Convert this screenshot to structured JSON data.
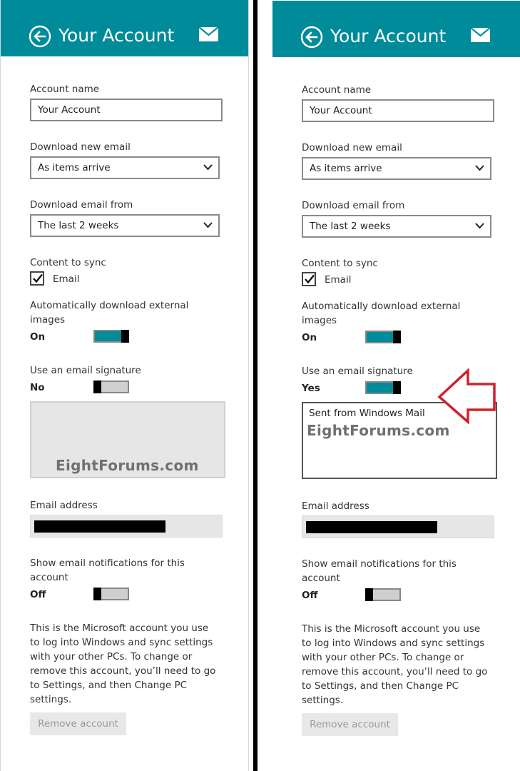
{
  "panels": [
    {
      "header": {
        "title": "Your Account"
      },
      "account_name": {
        "label": "Account name",
        "value": "Your Account"
      },
      "download_new": {
        "label": "Download new email",
        "value": "As items arrive"
      },
      "download_from": {
        "label": "Download email from",
        "value": "The last 2 weeks"
      },
      "content_sync": {
        "label": "Content to sync",
        "option": "Email",
        "checked": true
      },
      "external_images": {
        "label_line1": "Automatically download external",
        "label_line2": "images",
        "state": "On"
      },
      "signature": {
        "label": "Use an email signature",
        "state": "No",
        "text": ""
      },
      "watermark": "EightForums.com",
      "email_address": {
        "label": "Email address"
      },
      "notifications": {
        "label_line1": "Show email notifications for this",
        "label_line2": "account",
        "state": "Off"
      },
      "info_lines": [
        "This is the Microsoft account you use",
        "to log into Windows and sync settings",
        "with your other PCs. To change or",
        "remove this account, you’ll need to go",
        "to Settings, and then Change PC",
        "settings."
      ],
      "remove_label": "Remove account"
    },
    {
      "header": {
        "title": "Your Account"
      },
      "account_name": {
        "label": "Account name",
        "value": "Your Account"
      },
      "download_new": {
        "label": "Download new email",
        "value": "As items arrive"
      },
      "download_from": {
        "label": "Download email from",
        "value": "The last 2 weeks"
      },
      "content_sync": {
        "label": "Content to sync",
        "option": "Email",
        "checked": true
      },
      "external_images": {
        "label_line1": "Automatically download external",
        "label_line2": "images",
        "state": "On"
      },
      "signature": {
        "label": "Use an email signature",
        "state": "Yes",
        "text": "Sent from Windows Mail"
      },
      "watermark": "EightForums.com",
      "email_address": {
        "label": "Email address"
      },
      "notifications": {
        "label_line1": "Show email notifications for this",
        "label_line2": "account",
        "state": "Off"
      },
      "info_lines": [
        "This is the Microsoft account you use",
        "to log into Windows and sync settings",
        "with your other PCs. To change or",
        "remove this account, you’ll need to go",
        "to Settings, and then Change PC",
        "settings."
      ],
      "remove_label": "Remove account"
    }
  ],
  "colors": {
    "accent": "#008b9a",
    "annotation_arrow": "#d0212b"
  },
  "icons": {
    "back": "back-arrow-circle-icon",
    "mail": "mail-envelope-icon",
    "dropdown": "chevron-down-icon",
    "check": "checkmark-icon"
  }
}
